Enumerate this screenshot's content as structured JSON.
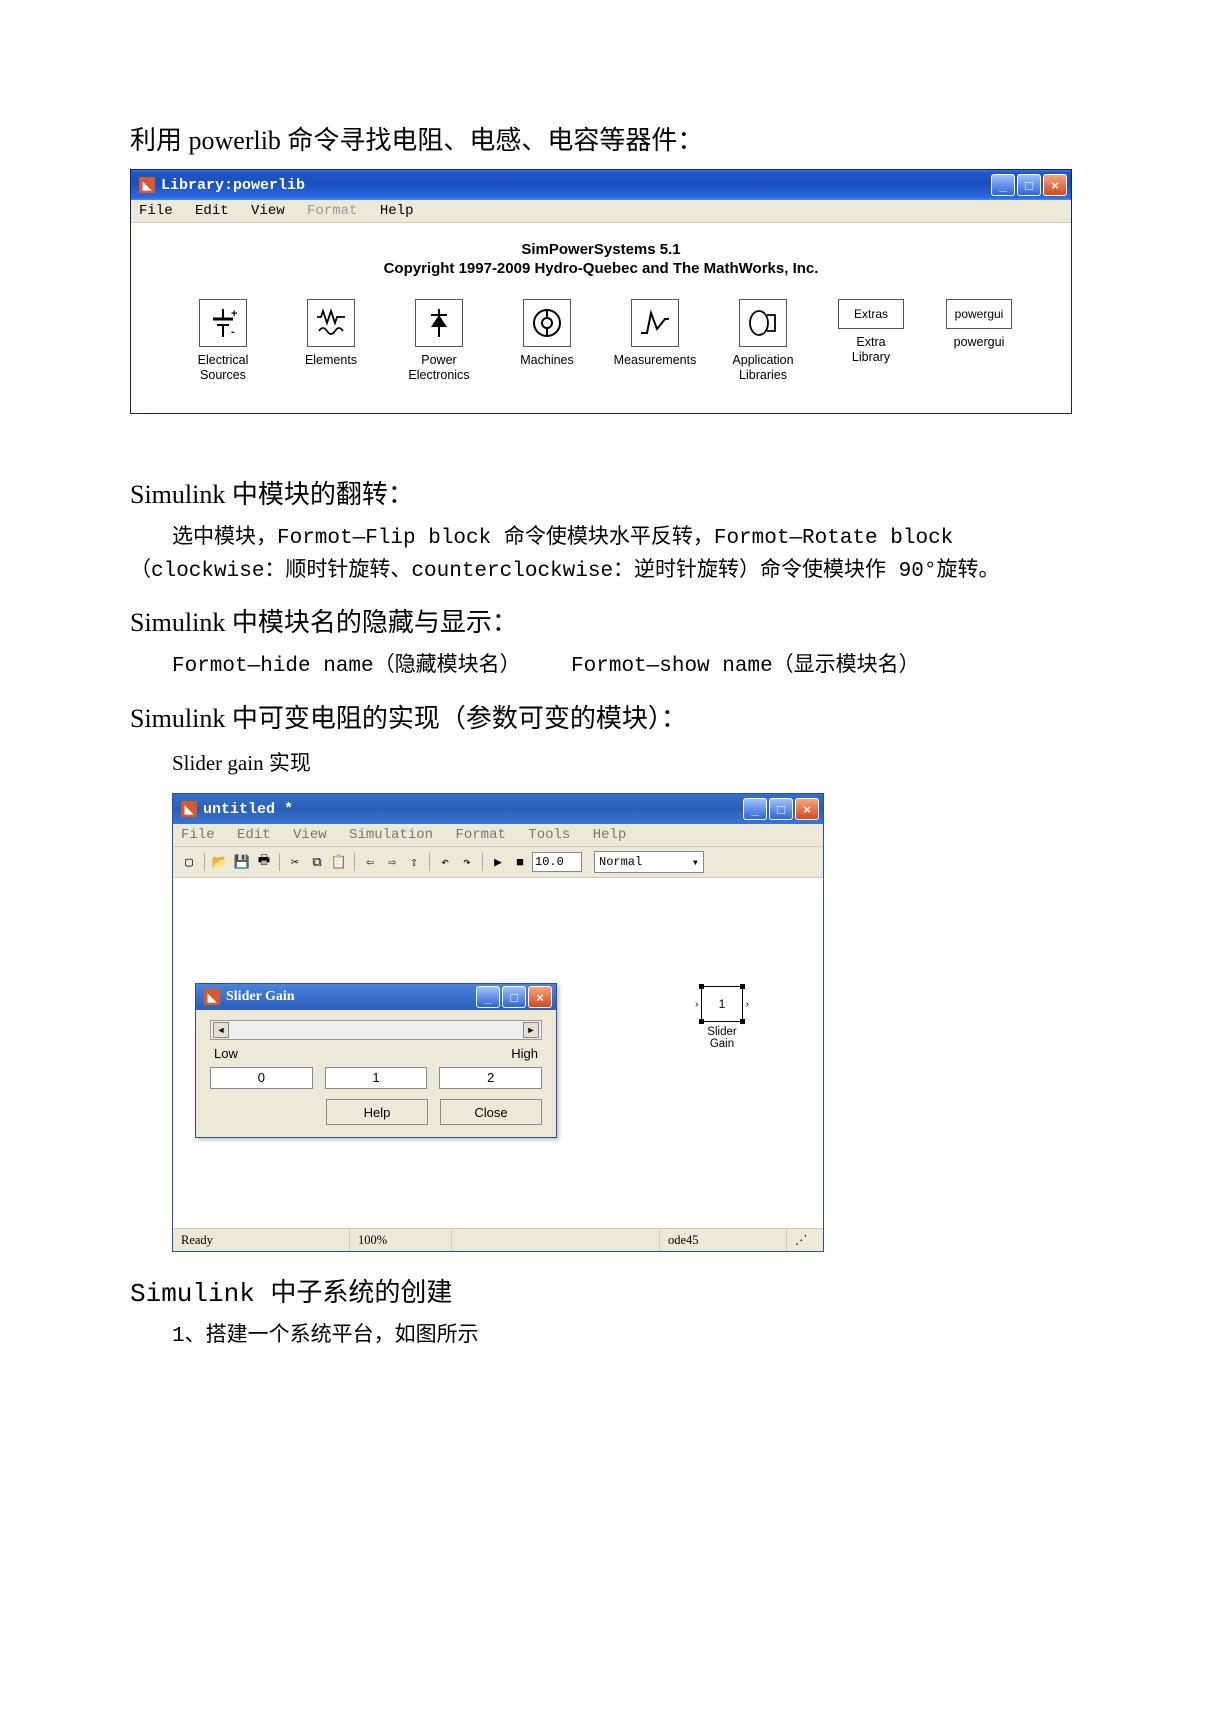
{
  "section1": {
    "title": "利用 powerlib 命令寻找电阻、电感、电容等器件："
  },
  "win1": {
    "title": "Library:powerlib",
    "menu": {
      "file": "File",
      "edit": "Edit",
      "view": "View",
      "format": "Format",
      "help": "Help"
    },
    "head1": "SimPowerSystems 5.1",
    "head2": "Copyright 1997-2009 Hydro-Quebec and The MathWorks, Inc.",
    "items": [
      {
        "label": "Electrical\nSources"
      },
      {
        "label": "Elements"
      },
      {
        "label": "Power\nElectronics"
      },
      {
        "label": "Machines"
      },
      {
        "label": "Measurements"
      },
      {
        "label": "Application\nLibraries"
      },
      {
        "label": "Extra\nLibrary",
        "boxtext": "Extras"
      },
      {
        "label": "powergui",
        "boxtext": "powergui"
      }
    ]
  },
  "section2": {
    "title": "Simulink 中模块的翻转：",
    "body": "选中模块，Formot—Flip block 命令使模块水平反转，Formot—Rotate block（clockwise：顺时针旋转、counterclockwise：逆时针旋转）命令使模块作 90°旋转。"
  },
  "section3": {
    "title": "Simulink 中模块名的隐藏与显示：",
    "body": "Formot—hide name（隐藏模块名）    Formot—show name（显示模块名）"
  },
  "section4": {
    "title": "Simulink 中可变电阻的实现（参数可变的模块）：",
    "sub": "Slider gain 实现"
  },
  "win2": {
    "title": "untitled *",
    "menu": {
      "file": "File",
      "edit": "Edit",
      "view": "View",
      "simulation": "Simulation",
      "format": "Format",
      "tools": "Tools",
      "help": "Help"
    },
    "stoptime": "10.0",
    "mode": "Normal",
    "status": {
      "ready": "Ready",
      "zoom": "100%",
      "solver": "ode45"
    },
    "block": {
      "value": "1",
      "label": "Slider\nGain"
    }
  },
  "dlg": {
    "title": "Slider Gain",
    "low_label": "Low",
    "high_label": "High",
    "low": "0",
    "mid": "1",
    "high": "2",
    "help": "Help",
    "close": "Close"
  },
  "section5": {
    "title": "Simulink 中子系统的创建",
    "body": "1、搭建一个系统平台，如图所示"
  }
}
